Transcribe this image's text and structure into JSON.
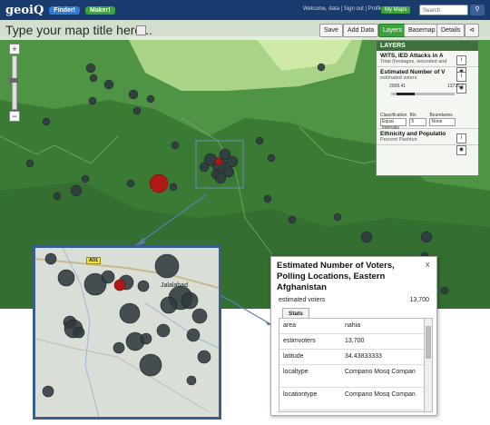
{
  "topbar": {
    "logo": "geoiQ",
    "finder_label": "Finder!",
    "maker_label": "Maker!",
    "welcome_text": "Welcome, data | Sign out | Profile",
    "my_maps_label": "My Maps",
    "search_placeholder": "Search"
  },
  "titlebar": {
    "map_title": "Type your map title here...",
    "buttons": {
      "save": "Save",
      "add_data": "Add Data",
      "layers": "Layers",
      "basemap": "Basemap",
      "details": "Details"
    }
  },
  "layers_panel": {
    "header": "LAYERS",
    "layers": [
      {
        "name": "WITS, IED Attacks in A",
        "sub": "Total (hostages, wounded and"
      },
      {
        "name": "Estimated Number of V",
        "sub": "estimated voters"
      },
      {
        "name": "Ethnicity and Populatio",
        "sub": "Percent Pashtun"
      }
    ],
    "range_low": "2008.41",
    "range_high": "13735.7",
    "classification_label": "Classification",
    "classification_value": "Equal Intervals",
    "bins_label": "Bin",
    "bins_value": "5",
    "boundary_label": "Boundaries",
    "boundary_value": "None"
  },
  "inset": {
    "road_badge": "A01",
    "place_label": "Jalalabad"
  },
  "popup": {
    "title": "Estimated Number of Voters, Polling Locations, Eastern Afghanistan",
    "close": "x",
    "metric_label": "estimated voters",
    "metric_value": "13,700",
    "tab_label": "Stats",
    "rows": [
      {
        "key": "area",
        "value": "nahia"
      },
      {
        "key": "estimvoters",
        "value": "13,700"
      },
      {
        "key": "latitude",
        "value": "34.43833333"
      },
      {
        "key": "localtype",
        "value": "Compano Mosq Compan"
      },
      {
        "key": "locationtype",
        "value": "Compano Mosq Compan"
      }
    ]
  },
  "colors": {
    "topbar": "#1a3b6e",
    "map_green_dark": "#3f7f3a",
    "map_green_light": "#bfe09a",
    "accent_green": "#3aa33a",
    "marker_dark": "#2f3a3f",
    "marker_red": "#b01818",
    "callout_blue": "#3a5f8a"
  }
}
